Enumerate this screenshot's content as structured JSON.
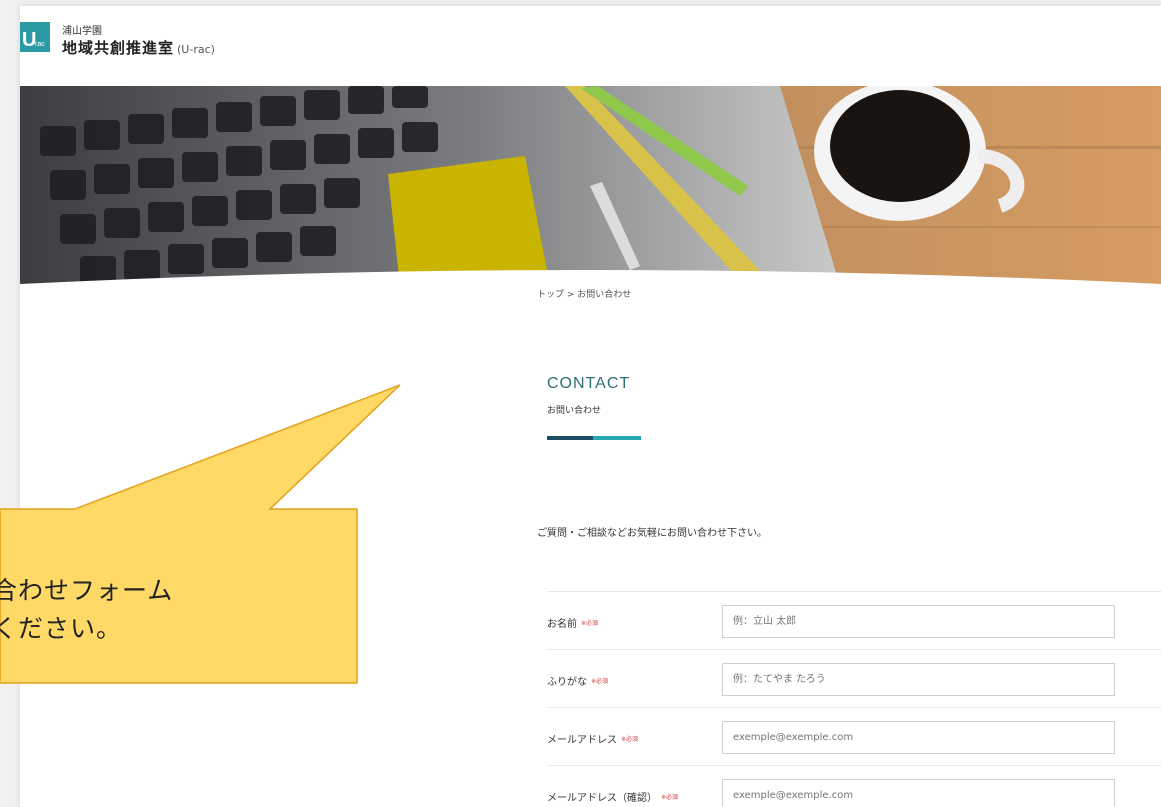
{
  "header": {
    "org_sub": "浦山学園",
    "org_main": "地域共創推進室",
    "org_main_en": "(U-rac)",
    "logo_letter": "U",
    "logo_small": "rac"
  },
  "breadcrumb": "トップ > お問い合わせ",
  "heading": {
    "en": "CONTACT",
    "ja": "お問い合わせ"
  },
  "intro": "ご質問・ご相談などお気軽にお問い合わせ下さい。",
  "form": {
    "required_mark": "※必須",
    "rows": [
      {
        "label": "お名前",
        "placeholder": "例：立山 太郎"
      },
      {
        "label": "ふりがな",
        "placeholder": "例：たてやま たろう"
      },
      {
        "label": "メールアドレス",
        "placeholder": "exemple@exemple.com"
      },
      {
        "label": "メールアドレス（確認）",
        "placeholder": "exemple@exemple.com"
      }
    ]
  },
  "callout": {
    "line1": "合わせフォーム",
    "line2": "ください。",
    "fill": "#ffd966",
    "stroke": "#e4a11b"
  },
  "colors": {
    "accent_dark": "#1d4e63",
    "accent": "#28a6b0",
    "required": "#d23b3b"
  }
}
